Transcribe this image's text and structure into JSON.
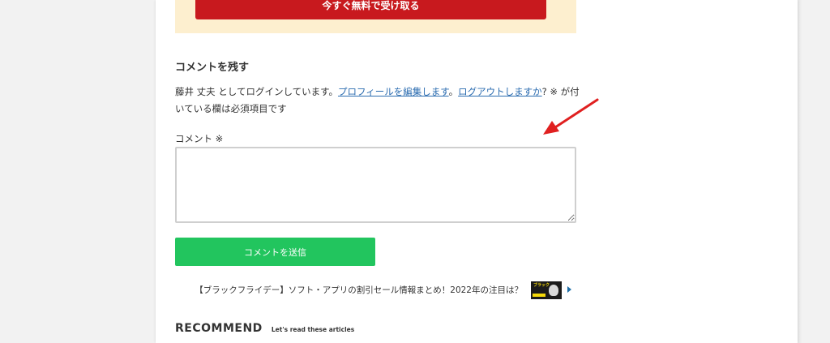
{
  "cta": {
    "button_label": "今すぐ無料で受け取る"
  },
  "comments": {
    "heading": "コメントを残す",
    "logged_in_prefix": "藤井 丈夫 としてログインしています。",
    "edit_profile_link": "プロフィールを編集します",
    "separator": "。",
    "logout_link": "ログアウトしますか",
    "required_note": "? ※ が付いている欄は必須項目です",
    "field_label": "コメント ※",
    "textarea_value": "",
    "submit_label": "コメントを送信"
  },
  "next_post": {
    "title": "【ブラックフライデー】ソフト・アプリの割引セール情報まとめ！2022年の注目は？",
    "thumbnail_text": "ブラック"
  },
  "recommend": {
    "title": "RECOMMEND",
    "subtitle": "Let's read these articles"
  },
  "colors": {
    "cta_background": "#fdefcf",
    "cta_button": "#c8191e",
    "submit_button": "#22c55e",
    "link": "#2b6cb0",
    "annotation_arrow": "#e02020"
  },
  "icons": {
    "next_arrow": "caret-right-icon",
    "annotation": "red-arrow-annotation"
  }
}
